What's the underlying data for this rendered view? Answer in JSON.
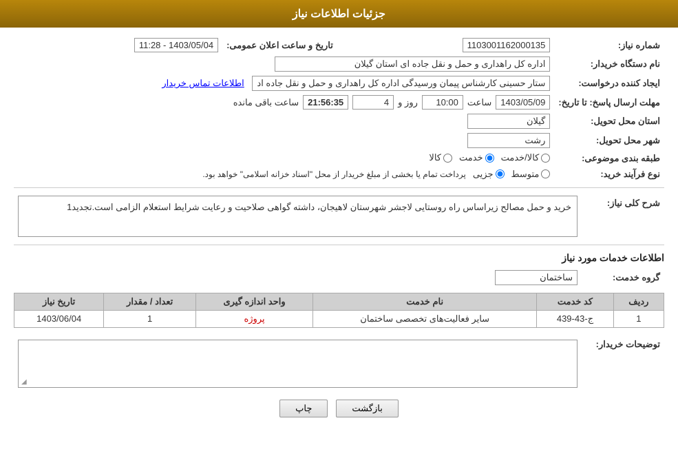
{
  "header": {
    "title": "جزئیات اطلاعات نیاز"
  },
  "fields": {
    "order_number_label": "شماره نیاز:",
    "order_number_value": "1103001162000135",
    "date_label": "تاریخ و ساعت اعلان عمومی:",
    "date_value": "1403/05/04 - 11:28",
    "buyer_label": "نام دستگاه خریدار:",
    "buyer_value": "اداره کل راهداری و حمل و نقل جاده ای استان گیلان",
    "creator_label": "ایجاد کننده درخواست:",
    "creator_value": "ستار حسینی کارشناس پیمان ورسیدگی اداره کل راهداری و حمل و نقل جاده اد",
    "creator_link": "اطلاعات تماس خریدار",
    "deadline_label": "مهلت ارسال پاسخ: تا تاریخ:",
    "deadline_date": "1403/05/09",
    "deadline_time_label": "ساعت",
    "deadline_time": "10:00",
    "deadline_day_label": "روز و",
    "deadline_days": "4",
    "deadline_remaining_label": "ساعت باقی مانده",
    "deadline_remaining": "21:56:35",
    "province_label": "استان محل تحویل:",
    "province_value": "گیلان",
    "city_label": "شهر محل تحویل:",
    "city_value": "رشت",
    "category_label": "طبقه بندی موضوعی:",
    "category_kala": "کالا",
    "category_khadamat": "خدمت",
    "category_kala_khadamat": "کالا/خدمت",
    "process_label": "نوع فرآیند خرید:",
    "process_jozyi": "جزیی",
    "process_motevaset": "متوسط",
    "process_note": "پرداخت تمام یا بخشی از مبلغ خریدار از محل \"اسناد خزانه اسلامی\" خواهد بود.",
    "description_label": "شرح کلی نیاز:",
    "description_text": "خرید و حمل مصالح زیراساس راه روستایی لاجشر شهرستان لاهیجان، داشته گواهی صلاحیت و رعایت شرایط استعلام الزامی است.تجدید1",
    "services_section": "اطلاعات خدمات مورد نیاز",
    "service_group_label": "گروه خدمت:",
    "service_group_value": "ساختمان",
    "table_headers": {
      "row_num": "ردیف",
      "service_code": "کد خدمت",
      "service_name": "نام خدمت",
      "unit": "واحد اندازه گیری",
      "quantity": "تعداد / مقدار",
      "date": "تاریخ نیاز"
    },
    "table_rows": [
      {
        "row_num": "1",
        "service_code": "ج-43-439",
        "service_name": "سایر فعالیت‌های تخصصی ساختمان",
        "unit": "پروژه",
        "quantity": "1",
        "date": "1403/06/04"
      }
    ],
    "buyer_notes_label": "توضیحات خریدار:"
  },
  "buttons": {
    "print": "چاپ",
    "back": "بازگشت"
  }
}
